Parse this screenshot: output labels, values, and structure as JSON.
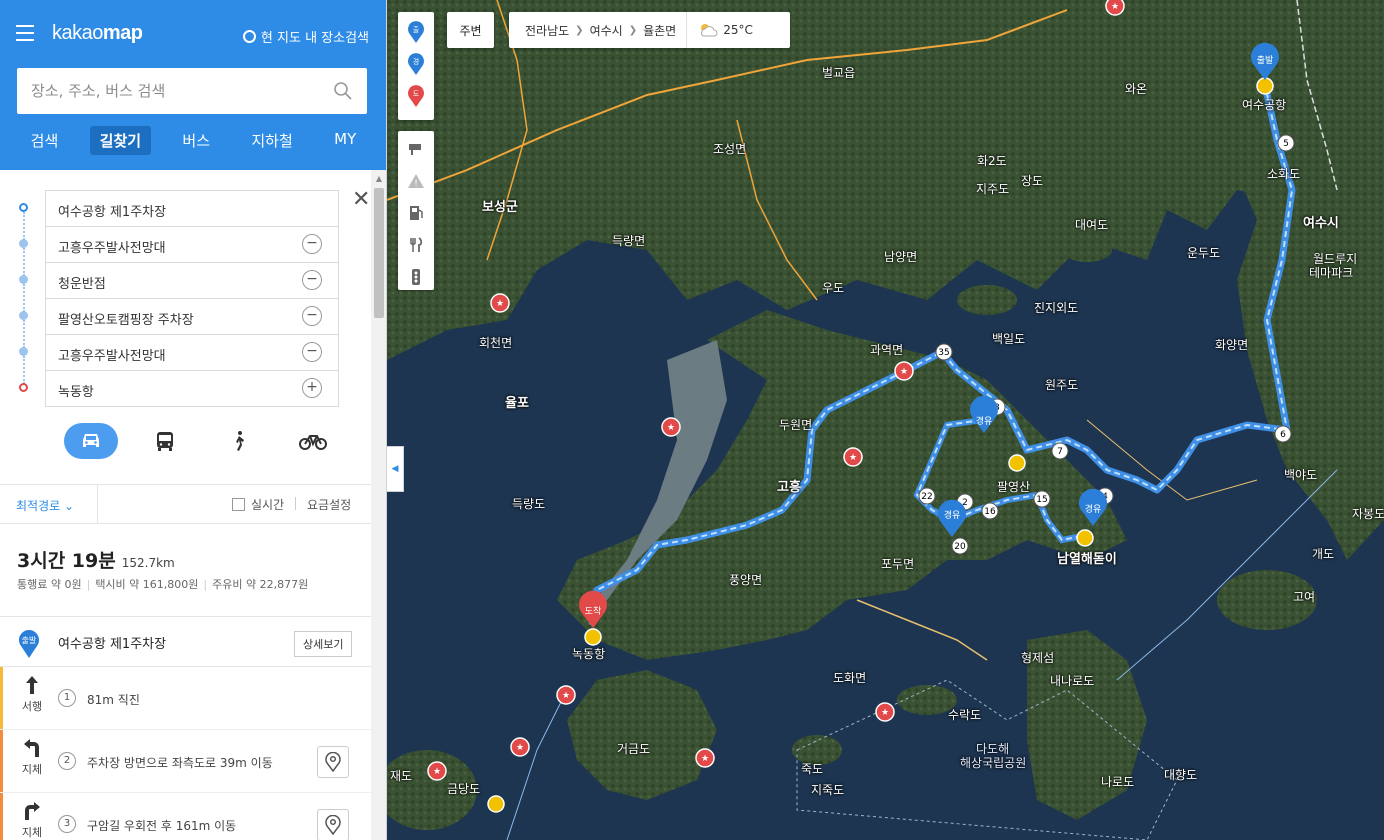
{
  "app": {
    "logo_a": "kakao",
    "logo_b": "map",
    "current_area_search": "현 지도 내 장소검색"
  },
  "search": {
    "placeholder": "장소, 주소, 버스 검색"
  },
  "tabs": [
    {
      "label": "검색"
    },
    {
      "label": "길찾기",
      "active": true
    },
    {
      "label": "버스"
    },
    {
      "label": "지하철"
    },
    {
      "label": "MY"
    }
  ],
  "waypoints": [
    {
      "name": "여수공항 제1주차장",
      "type": "start",
      "button": ""
    },
    {
      "name": "고흥우주발사전망대",
      "type": "via",
      "button": "−"
    },
    {
      "name": "청운반점",
      "type": "via",
      "button": "−"
    },
    {
      "name": "팔영산오토캠핑장 주차장",
      "type": "via",
      "button": "−"
    },
    {
      "name": "고흥우주발사전망대",
      "type": "via",
      "button": "−"
    },
    {
      "name": "녹동항",
      "type": "end",
      "button": "+"
    }
  ],
  "route_options": {
    "selected": "최적경로",
    "realtime": "실시간",
    "fare_settings": "요금설정"
  },
  "summary": {
    "time": "3시간 19분",
    "distance": "152.7km",
    "toll": "통행료 약 0원",
    "taxi": "택시비 약 161,800원",
    "fuel": "주유비 약 22,877원"
  },
  "start_step": {
    "badge": "출발",
    "name": "여수공항 제1주차장",
    "detail_button": "상세보기"
  },
  "steps": [
    {
      "num": "1",
      "dir_label": "서행",
      "text": "81m 직진",
      "has_view": false
    },
    {
      "num": "2",
      "dir_label": "지체",
      "text": "주차장 방면으로 좌측도로 39m 이동",
      "has_view": true
    },
    {
      "num": "3",
      "dir_label": "지체",
      "text": "구암길 우회전 후 161m 이동",
      "has_view": true
    }
  ],
  "map_toolbar": {
    "nearby": "주변",
    "breadcrumb": [
      "전라남도",
      "여수시",
      "율촌면"
    ],
    "temperature": "25°C",
    "route_tools": [
      "출",
      "경",
      "도"
    ]
  },
  "map_labels": {
    "boseong": "보성군",
    "hwacheon": "회천면",
    "yulpo": "율포",
    "deukryangdo": "득량도",
    "goheung": "고흥",
    "nokdong_port": "녹동항",
    "geogeumdo": "거금도",
    "geumdang": "금당도",
    "jaedo": "재도",
    "palyeongsan": "팔영산",
    "namyeol": "남열해돋이",
    "yeosu_si": "여수시",
    "waon": "와온",
    "daeyeodo": "대여도",
    "baegildo": "백일도",
    "jinjiwoedo": "진지외도",
    "wonjudo": "원주도",
    "naenarodo": "내나로도",
    "narodo": "나로도",
    "daehangdo": "대향도",
    "hyeongjeseom": "형제섬",
    "suracdo": "수락도",
    "dadohae": "다도해",
    "dadohae2": "해상국립공원",
    "jukdo": "죽도",
    "jijukdo": "지죽도",
    "gaedo": "개도",
    "goyeo": "고여",
    "woldo": "운두도",
    "woohado": "우도",
    "jajudo": "지주도",
    "jangdo": "장도",
    "hwado": "화2도",
    "podumyeon": "포두면",
    "dohwamyeon": "도화면",
    "yamyeon": "백야도",
    "woldeurirujo": "월드루지",
    "themepark": "테마파크",
    "yeosuport": "여수공항",
    "pungyang": "풍양면",
    "duwon": "두원면",
    "gwayeok": "과역면",
    "namyangmyeon": "남양면",
    "sohwado": "소화도",
    "jabongdo": "자봉도",
    "hwayangmyeon": "화양면",
    "beolgyo": "벌교읍",
    "joseongmyeon": "조성면",
    "deungryang": "득량면"
  },
  "markers": {
    "start": "출발",
    "via": "경유",
    "end": "도착"
  },
  "route_numbers": [
    "35",
    "3",
    "7",
    "15",
    "4",
    "16",
    "2",
    "22",
    "20",
    "6",
    "5"
  ],
  "colors": {
    "brand": "#2e8ce6",
    "route": "#4fa3f7",
    "start_pin": "#2b7fd8",
    "end_pin": "#e24a4a",
    "toll_road": "#f0a53a"
  }
}
